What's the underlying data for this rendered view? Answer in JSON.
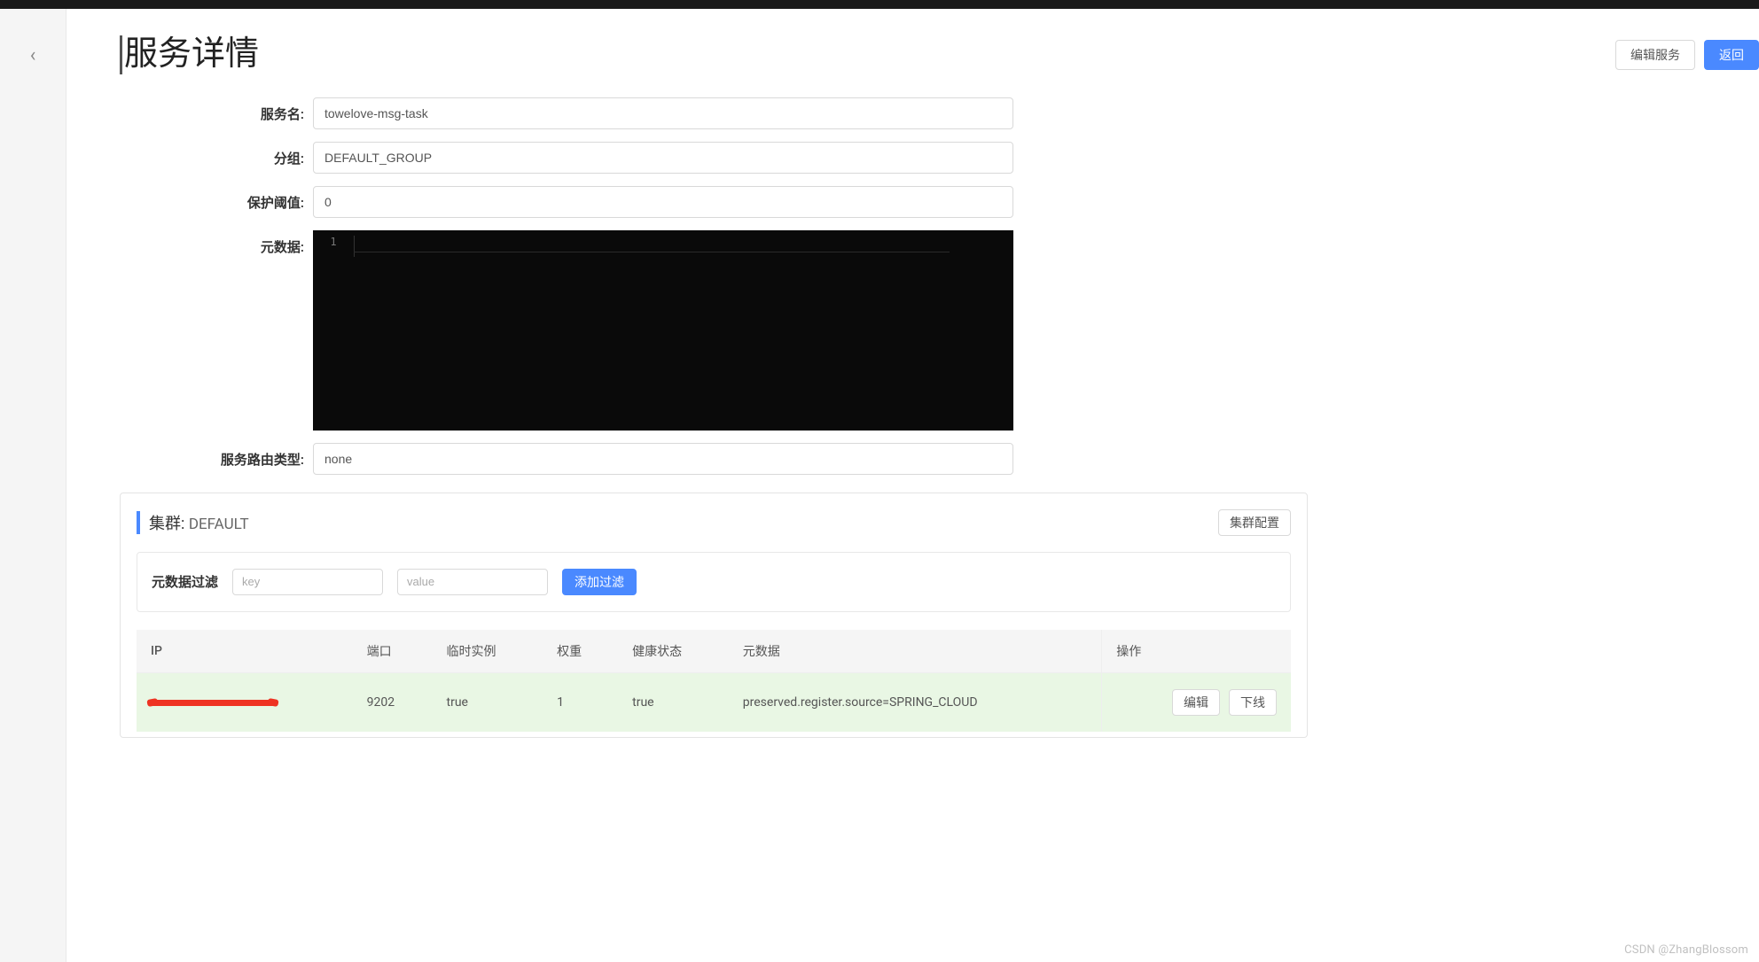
{
  "page": {
    "title": "服务详情"
  },
  "header_buttons": {
    "edit": "编辑服务",
    "back": "返回"
  },
  "form": {
    "labels": {
      "service_name": "服务名:",
      "group": "分组:",
      "threshold": "保护阈值:",
      "metadata": "元数据:",
      "route_type": "服务路由类型:"
    },
    "values": {
      "service_name": "towelove-msg-task",
      "group": "DEFAULT_GROUP",
      "threshold": "0",
      "route_type": "none"
    },
    "editor": {
      "line_number": "1"
    }
  },
  "cluster": {
    "title_label": "集群:",
    "name": "DEFAULT",
    "config_btn": "集群配置",
    "filter": {
      "label": "元数据过滤",
      "key_placeholder": "key",
      "value_placeholder": "value",
      "add_btn": "添加过滤"
    },
    "table": {
      "headers": {
        "ip": "IP",
        "port": "端口",
        "ephemeral": "临时实例",
        "weight": "权重",
        "health": "健康状态",
        "metadata": "元数据",
        "op": "操作"
      },
      "rows": [
        {
          "ip_redacted": true,
          "port": "9202",
          "ephemeral": "true",
          "weight": "1",
          "health": "true",
          "metadata": "preserved.register.source=SPRING_CLOUD"
        }
      ],
      "row_actions": {
        "edit": "编辑",
        "offline": "下线"
      }
    }
  },
  "watermark": "CSDN @ZhangBlossom"
}
